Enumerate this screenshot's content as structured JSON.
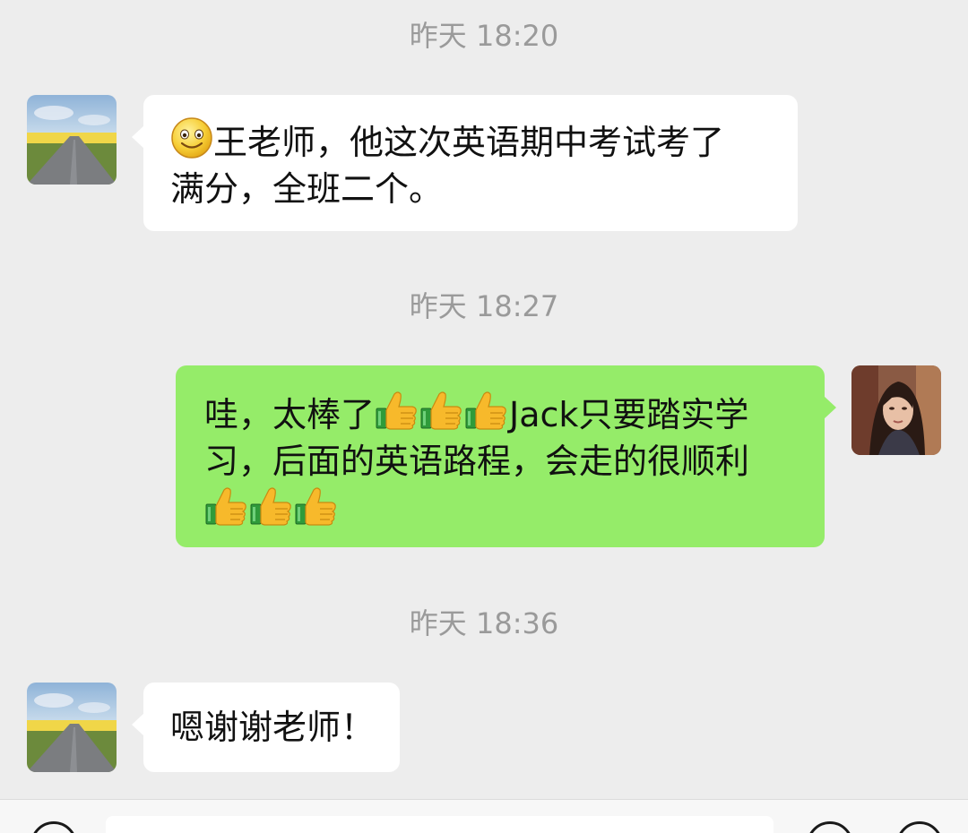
{
  "messages": [
    {
      "timestamp": "昨天 18:20",
      "side": "left",
      "lead_emoji": "smile-emoji",
      "lines": [
        "王老师，他这次英语期中考试考了",
        "满分，全班二个。"
      ]
    },
    {
      "timestamp": "昨天 18:27",
      "side": "right",
      "line1_a": "哇，太棒了",
      "line1_b": "Jack只要踏实学",
      "line2": "习，后面的英语路程，会走的很顺利",
      "thumb_emoji": "thumbs-up-emoji"
    },
    {
      "timestamp": "昨天 18:36",
      "side": "left",
      "lines": [
        "嗯谢谢老师！"
      ]
    }
  ],
  "colors": {
    "background": "#ededed",
    "left_bubble": "#ffffff",
    "right_bubble": "#95ec69",
    "timestamp_text": "#9a9a9a"
  },
  "icons": {
    "left_avatar": "road-landscape-avatar",
    "right_avatar": "woman-portrait-avatar",
    "input_left": "voice-icon",
    "input_right_1": "emoji-icon",
    "input_right_2": "plus-icon"
  }
}
